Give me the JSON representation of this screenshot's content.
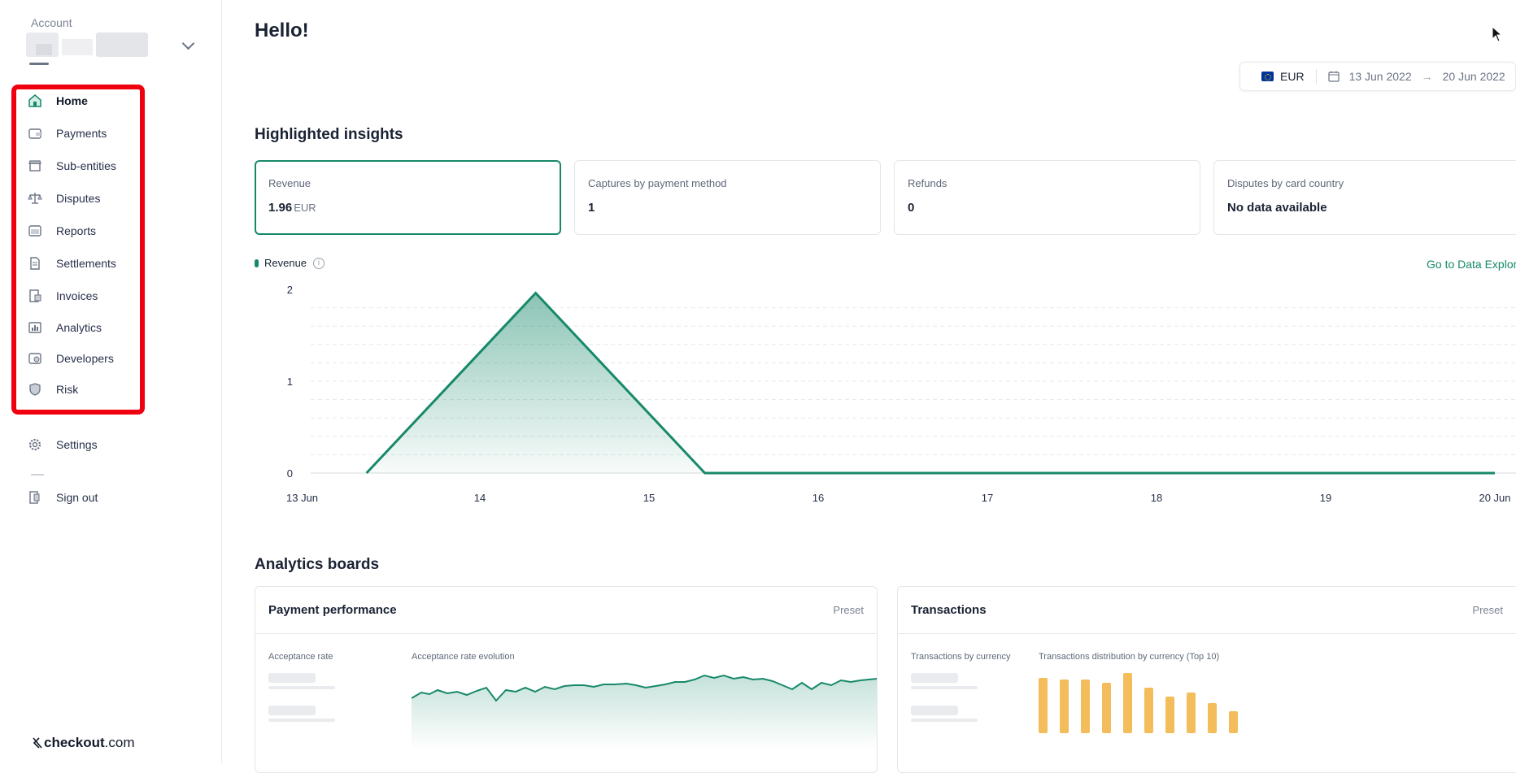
{
  "sidebar": {
    "account_label": "Account",
    "items": [
      {
        "label": "Home",
        "icon": "home-icon",
        "active": true
      },
      {
        "label": "Payments",
        "icon": "wallet-icon"
      },
      {
        "label": "Sub-entities",
        "icon": "store-icon"
      },
      {
        "label": "Disputes",
        "icon": "scale-icon"
      },
      {
        "label": "Reports",
        "icon": "report-icon"
      },
      {
        "label": "Settlements",
        "icon": "document-icon"
      },
      {
        "label": "Invoices",
        "icon": "invoice-icon"
      },
      {
        "label": "Analytics",
        "icon": "analytics-icon"
      },
      {
        "label": "Developers",
        "icon": "code-icon"
      },
      {
        "label": "Risk",
        "icon": "shield-icon"
      }
    ],
    "settings_label": "Settings",
    "signout_label": "Sign out",
    "logo": {
      "bold": "checkout",
      "rest": ".com"
    }
  },
  "header": {
    "greeting": "Hello!"
  },
  "filter": {
    "currency": "EUR",
    "date_from": "13 Jun 2022",
    "arrow": "→",
    "date_to": "20 Jun 2022"
  },
  "insights": {
    "title": "Highlighted insights",
    "cards": [
      {
        "title": "Revenue",
        "value": "1.96",
        "unit": "EUR"
      },
      {
        "title": "Captures by payment method",
        "value": "1",
        "unit": ""
      },
      {
        "title": "Refunds",
        "value": "0",
        "unit": ""
      },
      {
        "title": "Disputes by card country",
        "value": "No data available",
        "unit": ""
      }
    ]
  },
  "chart_legend": {
    "label": "Revenue",
    "info": "i"
  },
  "explore_link": "Go to Data Explorer",
  "chart_data": {
    "type": "area",
    "x": [
      "13 Jun",
      "14",
      "15",
      "16",
      "17",
      "18",
      "19",
      "20 Jun"
    ],
    "series": [
      {
        "name": "Revenue",
        "points": [
          [
            0.33,
            0
          ],
          [
            1.33,
            1.96
          ],
          [
            2.33,
            0
          ],
          [
            7.0,
            0
          ]
        ]
      }
    ],
    "yticks": [
      "0",
      "1",
      "2"
    ],
    "ylim": [
      0,
      2
    ],
    "grid": true,
    "color": "#17896a"
  },
  "boards": {
    "title": "Analytics boards",
    "items": [
      {
        "title": "Payment performance",
        "preset": "Preset",
        "metric": "Acceptance rate",
        "chart_title": "Acceptance rate evolution"
      },
      {
        "title": "Transactions",
        "preset": "Preset",
        "metric": "Transactions by currency",
        "chart_title": "Transactions distribution by currency (Top 10)"
      }
    ]
  },
  "colors": {
    "accent": "#17896a",
    "highlight": "#f0000f",
    "bars": "#f3bd5b"
  }
}
